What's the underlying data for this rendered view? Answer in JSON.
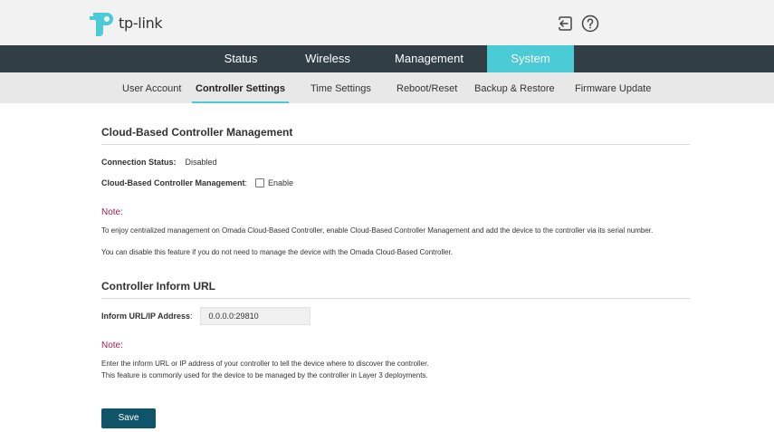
{
  "header": {
    "brand": "tp-link",
    "logout_icon": "logout-icon",
    "help_icon": "help-icon"
  },
  "top_nav": [
    {
      "label": "Status",
      "active": false
    },
    {
      "label": "Wireless",
      "active": false
    },
    {
      "label": "Management",
      "active": false
    },
    {
      "label": "System",
      "active": true
    }
  ],
  "sub_nav": [
    {
      "label": "User Account",
      "active": false
    },
    {
      "label": "Controller Settings",
      "active": true
    },
    {
      "label": "Time Settings",
      "active": false
    },
    {
      "label": "Reboot/Reset",
      "active": false
    },
    {
      "label": "Backup & Restore",
      "active": false
    },
    {
      "label": "Firmware Update",
      "active": false
    }
  ],
  "cloud_section": {
    "title": "Cloud-Based Controller Management",
    "connection_status_label": "Connection Status",
    "connection_status_value": "Disabled",
    "management_label": "Cloud-Based Controller Management",
    "enable_label": "Enable",
    "enable_checked": false,
    "note_title": "Note:",
    "note_lines": [
      "To enjoy centralized management on Omada Cloud-Based Controller, enable Cloud-Based Controller Management and add the device to the controller via its serial number.",
      "You can disable this feature if you do not need to manage the device with the Omada Cloud-Based Controller."
    ]
  },
  "inform_section": {
    "title": "Controller Inform URL",
    "url_label": "Inform URL/IP Address",
    "url_value": "0.0.0.0:29810",
    "note_title": "Note:",
    "note_lines": [
      "Enter the inform URL or IP address of your controller to tell the device where to discover the controller.",
      "This feature is commonly used for the device to be managed by the controller in Layer 3 deployments."
    ]
  },
  "save_label": "Save",
  "colors": {
    "top_nav_bg": "#313e46",
    "accent": "#4acbd6",
    "note_title": "#a0224a",
    "save_button": "#0f5468"
  }
}
